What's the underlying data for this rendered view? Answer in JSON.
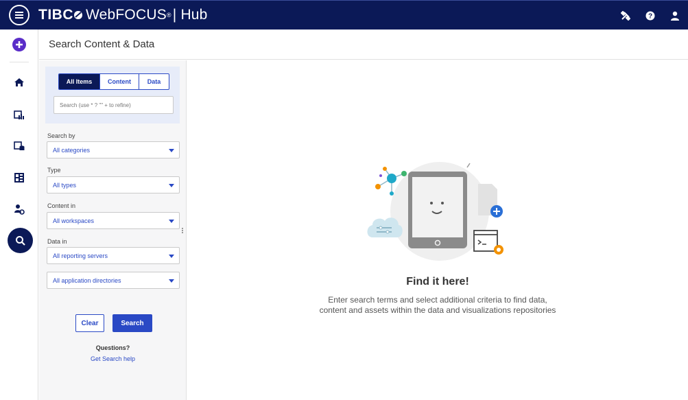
{
  "header": {
    "brand": "TIBC",
    "product": "WebFOCUS",
    "registered": "®",
    "section": "| Hub",
    "icons": [
      "tools-icon",
      "help-icon",
      "user-icon"
    ]
  },
  "rail": {
    "items": [
      "add-icon",
      "home-icon",
      "content-icon",
      "data-icon",
      "visualize-icon",
      "management-icon",
      "search-icon"
    ]
  },
  "page": {
    "title": "Search Content & Data"
  },
  "panel": {
    "tabs": [
      {
        "label": "All Items",
        "active": true
      },
      {
        "label": "Content",
        "active": false
      },
      {
        "label": "Data",
        "active": false
      }
    ],
    "search_placeholder": "Search (use * ? \"\" + to refine)",
    "search_by_label": "Search by",
    "search_by_value": "All categories",
    "type_label": "Type",
    "type_value": "All types",
    "content_in_label": "Content in",
    "content_in_value": "All workspaces",
    "data_in_label": "Data in",
    "data_in_value": "All reporting servers",
    "app_dirs_value": "All application directories",
    "clear_label": "Clear",
    "search_label": "Search",
    "questions_label": "Questions?",
    "help_link": "Get Search help"
  },
  "empty_state": {
    "title": "Find it here!",
    "line1": "Enter search terms and select additional criteria to find data,",
    "line2": "content and assets within the data and visualizations repositories"
  },
  "colors": {
    "navy": "#0b1957",
    "accent": "#2a49c5",
    "orange": "#f39200",
    "teal": "#1fa9c9"
  }
}
